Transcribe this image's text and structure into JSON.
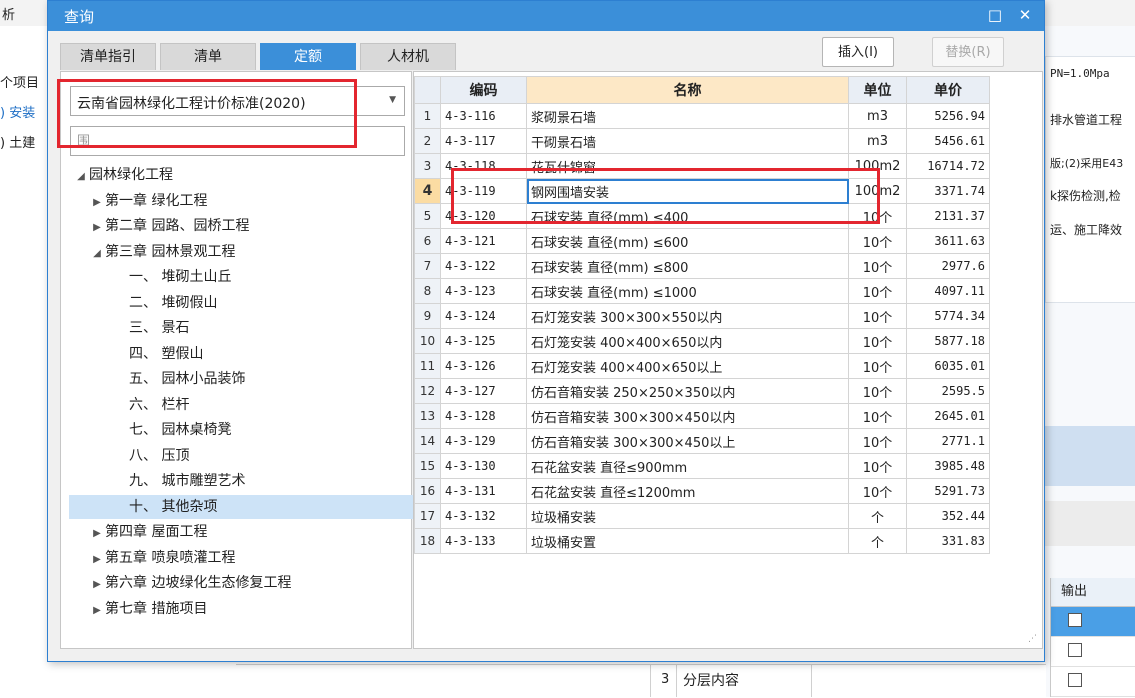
{
  "background": {
    "left_texts": [
      "析",
      "个项目",
      ") 安装",
      ") 土建"
    ],
    "right_texts": [
      "PN=1.0Mpa",
      "排水管道工程",
      "版;(2)采用E43",
      "k探伤检测,检",
      "运、施工降效"
    ],
    "output_header": "输出",
    "bottom_row": {
      "num": "3",
      "label": "分层内容"
    }
  },
  "dialog": {
    "title": "查询",
    "min_label": "□",
    "close_label": "✕",
    "tabs": [
      {
        "label": "清单指引",
        "active": false
      },
      {
        "label": "清单",
        "active": false
      },
      {
        "label": "定额",
        "active": true
      },
      {
        "label": "人材机",
        "active": false
      }
    ],
    "insert_button": "插入(I)",
    "replace_button": "替换(R)",
    "library_select": "云南省园林绿化工程计价标准(2020)",
    "search_placeholder": "围",
    "tree": [
      {
        "label": "园林绿化工程",
        "caret": "◢",
        "level": 0
      },
      {
        "label": "第一章 绿化工程",
        "caret": "▶",
        "level": 1
      },
      {
        "label": "第二章 园路、园桥工程",
        "caret": "▶",
        "level": 1
      },
      {
        "label": "第三章 园林景观工程",
        "caret": "◢",
        "level": 1
      },
      {
        "label": "一、 堆砌土山丘",
        "caret": "",
        "level": 2
      },
      {
        "label": "二、 堆砌假山",
        "caret": "",
        "level": 2
      },
      {
        "label": "三、 景石",
        "caret": "",
        "level": 2
      },
      {
        "label": "四、 塑假山",
        "caret": "",
        "level": 2
      },
      {
        "label": "五、 园林小品装饰",
        "caret": "",
        "level": 2
      },
      {
        "label": "六、 栏杆",
        "caret": "",
        "level": 2
      },
      {
        "label": "七、 园林桌椅凳",
        "caret": "",
        "level": 2
      },
      {
        "label": "八、 压顶",
        "caret": "",
        "level": 2
      },
      {
        "label": "九、 城市雕塑艺术",
        "caret": "",
        "level": 2
      },
      {
        "label": "十、 其他杂项",
        "caret": "",
        "level": 2,
        "selected": true
      },
      {
        "label": "第四章 屋面工程",
        "caret": "▶",
        "level": 1
      },
      {
        "label": "第五章 喷泉喷灌工程",
        "caret": "▶",
        "level": 1
      },
      {
        "label": "第六章 边坡绿化生态修复工程",
        "caret": "▶",
        "level": 1
      },
      {
        "label": "第七章 措施项目",
        "caret": "▶",
        "level": 1
      }
    ],
    "grid": {
      "headers": {
        "code": "编码",
        "name": "名称",
        "unit": "单位",
        "price": "单价"
      },
      "current_row": 4,
      "rows": [
        {
          "n": "1",
          "code": "4-3-116",
          "name": "浆砌景石墙",
          "unit": "m3",
          "price": "5256.94"
        },
        {
          "n": "2",
          "code": "4-3-117",
          "name": "干砌景石墙",
          "unit": "m3",
          "price": "5456.61"
        },
        {
          "n": "3",
          "code": "4-3-118",
          "name": "花瓦什锦窗",
          "unit": "100m2",
          "price": "16714.72"
        },
        {
          "n": "4",
          "code": "4-3-119",
          "name": "钢网围墙安装",
          "unit": "100m2",
          "price": "3371.74"
        },
        {
          "n": "5",
          "code": "4-3-120",
          "name": "石球安装 直径(mm) ≤400",
          "unit": "10个",
          "price": "2131.37"
        },
        {
          "n": "6",
          "code": "4-3-121",
          "name": "石球安装 直径(mm) ≤600",
          "unit": "10个",
          "price": "3611.63"
        },
        {
          "n": "7",
          "code": "4-3-122",
          "name": "石球安装 直径(mm) ≤800",
          "unit": "10个",
          "price": "2977.6"
        },
        {
          "n": "8",
          "code": "4-3-123",
          "name": "石球安装 直径(mm) ≤1000",
          "unit": "10个",
          "price": "4097.11"
        },
        {
          "n": "9",
          "code": "4-3-124",
          "name": "石灯笼安装 300×300×550以内",
          "unit": "10个",
          "price": "5774.34"
        },
        {
          "n": "10",
          "code": "4-3-125",
          "name": "石灯笼安装 400×400×650以内",
          "unit": "10个",
          "price": "5877.18"
        },
        {
          "n": "11",
          "code": "4-3-126",
          "name": "石灯笼安装 400×400×650以上",
          "unit": "10个",
          "price": "6035.01"
        },
        {
          "n": "12",
          "code": "4-3-127",
          "name": "仿石音箱安装 250×250×350以内",
          "unit": "10个",
          "price": "2595.5"
        },
        {
          "n": "13",
          "code": "4-3-128",
          "name": "仿石音箱安装 300×300×450以内",
          "unit": "10个",
          "price": "2645.01"
        },
        {
          "n": "14",
          "code": "4-3-129",
          "name": "仿石音箱安装 300×300×450以上",
          "unit": "10个",
          "price": "2771.1"
        },
        {
          "n": "15",
          "code": "4-3-130",
          "name": "石花盆安装 直径≤900mm",
          "unit": "10个",
          "price": "3985.48"
        },
        {
          "n": "16",
          "code": "4-3-131",
          "name": "石花盆安装 直径≤1200mm",
          "unit": "10个",
          "price": "5291.73"
        },
        {
          "n": "17",
          "code": "4-3-132",
          "name": "垃圾桶安装",
          "unit": "个",
          "price": "352.44"
        },
        {
          "n": "18",
          "code": "4-3-133",
          "name": "垃圾桶安置",
          "unit": "个",
          "price": "331.83"
        }
      ]
    },
    "colors": {
      "accent": "#3b8fd9",
      "annotation": "#e3262f"
    }
  }
}
